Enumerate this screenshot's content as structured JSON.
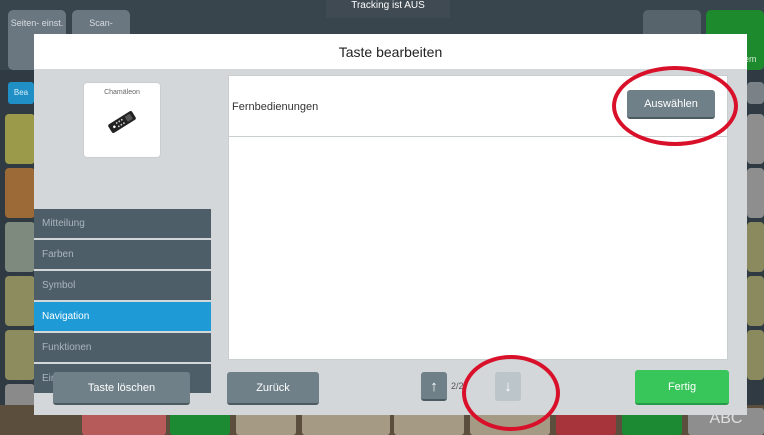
{
  "background": {
    "top_buttons": [
      "Seiten-\neinst.",
      "Scan-"
    ],
    "tracking_status": "Tracking ist AUS",
    "left_tab": "Bea",
    "right_cut": "em",
    "bottom_cut": "ABC"
  },
  "dialog": {
    "title": "Taste bearbeiten",
    "preview": {
      "label": "Chamäleon",
      "icon": "remote-control-icon"
    },
    "menu": [
      {
        "label": "Mitteilung",
        "active": false
      },
      {
        "label": "Farben",
        "active": false
      },
      {
        "label": "Symbol",
        "active": false
      },
      {
        "label": "Navigation",
        "active": true
      },
      {
        "label": "Funktionen",
        "active": false
      },
      {
        "label": "Einstellungen",
        "active": false
      }
    ],
    "delete_label": "Taste löschen",
    "content": {
      "row_label": "Fernbedienungen",
      "select_label": "Auswählen"
    },
    "footer": {
      "back_label": "Zurück",
      "up_icon": "↑",
      "page": "2/2",
      "down_icon": "↓",
      "done_label": "Fertig"
    }
  },
  "colors": {
    "accent_blue": "#1e9bd7",
    "done_green": "#38c55a",
    "annotation_red": "#d8102a",
    "button_gray": "#6f8088"
  }
}
